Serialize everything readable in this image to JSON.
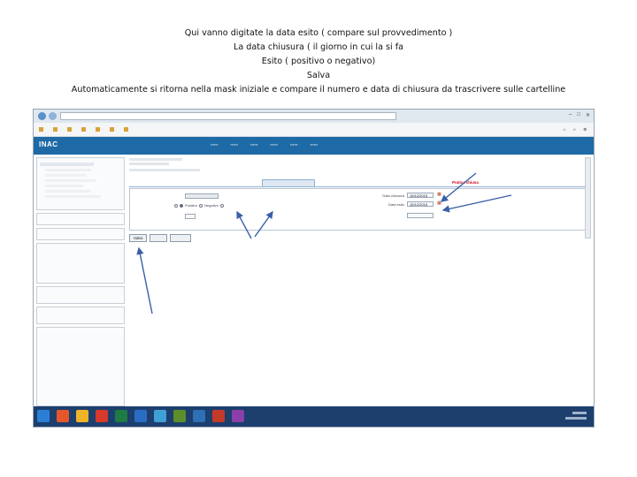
{
  "caption": {
    "line1": "Qui vanno digitate la data esito ( compare sul provvedimento )",
    "line2": "La data chiusura ( il giorno in cui la si fa",
    "line3": "Esito ( positivo o negativo)",
    "line4": "Salva",
    "line5": "Automaticamente si ritorna nella mask iniziale e compare il numero e data di chiusura da trascrivere sulle cartelline"
  },
  "app": {
    "logo": "INAC",
    "tab_red_label": "Pratica chiusa"
  },
  "colors": {
    "header_blue": "#1e6aa6",
    "taskbar": "#1c3f6e",
    "highlight_red": "#d0021b",
    "arrow": "#3a5fa8"
  },
  "form": {
    "date_esito_label": "Data chiusura",
    "date_esito_value": "15/12/2015",
    "date_chiusura_label": "Data esito",
    "date_chiusura_value": "15/12/2015",
    "esito_options": [
      "Positivo",
      "Negativo"
    ],
    "save_label": "Salva"
  }
}
